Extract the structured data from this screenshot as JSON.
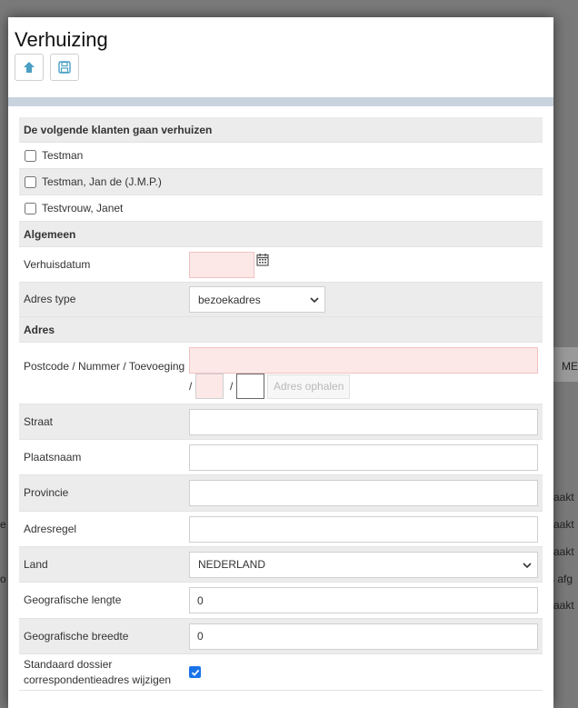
{
  "background": {
    "column_header": "ME",
    "rows": [
      {
        "prefix": "",
        "suffix": "aakt"
      },
      {
        "prefix": "e",
        "suffix": "aakt"
      },
      {
        "prefix": "",
        "suffix": "aakt"
      },
      {
        "prefix": "o",
        "suffix": "s afg"
      },
      {
        "prefix": "",
        "suffix": "aakt"
      }
    ]
  },
  "modal": {
    "title": "Verhuizing",
    "toolbar": {
      "upload_icon": "arrow-up-icon",
      "save_icon": "floppy-disk-icon"
    }
  },
  "clients": {
    "heading": "De volgende klanten gaan verhuizen",
    "items": [
      {
        "label": "Testman",
        "checked": false
      },
      {
        "label": "Testman, Jan de (J.M.P.)",
        "checked": false
      },
      {
        "label": "Testvrouw, Janet",
        "checked": false
      }
    ]
  },
  "general": {
    "heading": "Algemeen",
    "move_date_label": "Verhuisdatum",
    "move_date_value": "",
    "address_type_label": "Adres type",
    "address_type_value": "bezoekadres"
  },
  "address": {
    "heading": "Adres",
    "postcode_label": "Postcode / Nummer / Toevoeging",
    "postcode_value": "",
    "number_value": "",
    "suffix_value": "",
    "fetch_button": "Adres ophalen",
    "street_label": "Straat",
    "street_value": "",
    "city_label": "Plaatsnaam",
    "city_value": "",
    "province_label": "Provincie",
    "province_value": "",
    "address_line_label": "Adresregel",
    "address_line_value": "",
    "country_label": "Land",
    "country_value": "NEDERLAND",
    "longitude_label": "Geografische lengte",
    "longitude_value": "0",
    "latitude_label": "Geografische breedte",
    "latitude_value": "0",
    "default_correspondence_label": "Standaard dossier correspondentieadres wijzigen",
    "default_correspondence_checked": true
  },
  "colors": {
    "accent": "#4a9fc4",
    "required_bg": "#fde8e8",
    "section_bg": "#ececec",
    "divider": "#c8d3de"
  }
}
